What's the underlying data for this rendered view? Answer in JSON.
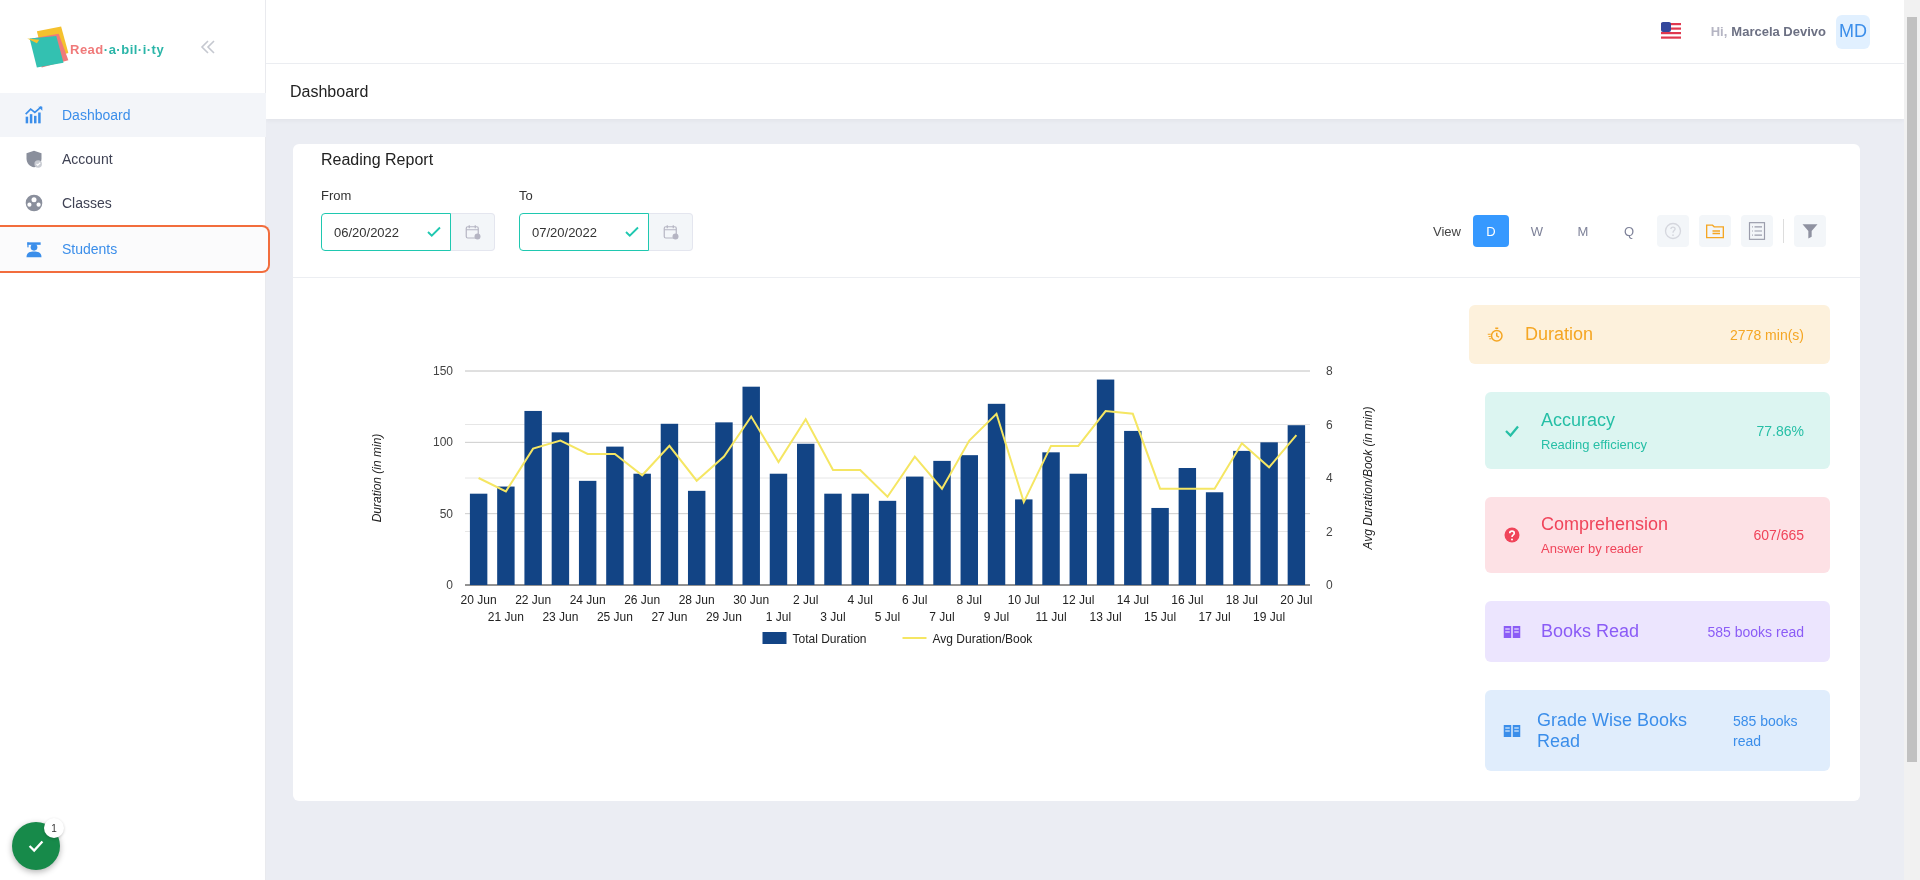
{
  "logo": {
    "parts": [
      "Read",
      "·a·bil·i·ty"
    ]
  },
  "sidebar": {
    "items": [
      {
        "label": "Dashboard",
        "kind": "chart",
        "selected": true,
        "highlighted": false
      },
      {
        "label": "Account",
        "kind": "shield",
        "selected": false,
        "highlighted": false
      },
      {
        "label": "Classes",
        "kind": "group",
        "selected": false,
        "highlighted": false
      },
      {
        "label": "Students",
        "kind": "student",
        "selected": false,
        "highlighted": true
      }
    ]
  },
  "header": {
    "greeting": "Hi,",
    "user_name": "Marcela Devivo",
    "avatar": "MD"
  },
  "page_title": "Dashboard",
  "report": {
    "title": "Reading Report",
    "from": {
      "label": "From",
      "value": "06/20/2022"
    },
    "to": {
      "label": "To",
      "value": "07/20/2022"
    },
    "view": {
      "label": "View",
      "options": [
        {
          "label": "D",
          "selected": true
        },
        {
          "label": "W",
          "selected": false
        },
        {
          "label": "M",
          "selected": false
        },
        {
          "label": "Q",
          "selected": false
        }
      ]
    },
    "chart_data": {
      "type": "bar",
      "ylabel": "Duration (in min)",
      "y2label": "Avg Duration/Book (in min)",
      "categories": [
        "20 Jun",
        "21 Jun",
        "22 Jun",
        "23 Jun",
        "24 Jun",
        "25 Jun",
        "26 Jun",
        "27 Jun",
        "28 Jun",
        "29 Jun",
        "30 Jun",
        "1 Jul",
        "2 Jul",
        "3 Jul",
        "4 Jul",
        "5 Jul",
        "6 Jul",
        "7 Jul",
        "8 Jul",
        "9 Jul",
        "10 Jul",
        "11 Jul",
        "12 Jul",
        "13 Jul",
        "14 Jul",
        "15 Jul",
        "16 Jul",
        "17 Jul",
        "18 Jul",
        "19 Jul",
        "20 Jul"
      ],
      "series": [
        {
          "name": "Total Duration",
          "type": "bar",
          "color": "#124485",
          "values": [
            64,
            69,
            122,
            107,
            73,
            97,
            78,
            113,
            66,
            114,
            139,
            78,
            99,
            64,
            64,
            59,
            76,
            87,
            91,
            127,
            60,
            93,
            78,
            144,
            108,
            54,
            82,
            65,
            94,
            100,
            112
          ]
        },
        {
          "name": "Avg Duration/Book",
          "type": "line",
          "axis": "y2",
          "color": "#f5e663",
          "values": [
            4.0,
            3.5,
            5.1,
            5.4,
            4.9,
            4.9,
            4.1,
            5.2,
            3.9,
            4.8,
            6.3,
            4.6,
            6.2,
            4.3,
            4.3,
            3.3,
            4.8,
            3.6,
            5.4,
            6.4,
            3.1,
            5.2,
            5.2,
            6.5,
            6.4,
            3.6,
            3.6,
            3.6,
            5.3,
            4.4,
            5.6
          ]
        }
      ],
      "grid": true,
      "legend": "bottom",
      "ylim": [
        0,
        150
      ],
      "yticks": [
        0,
        50,
        100,
        150
      ],
      "y2lim": [
        0,
        8
      ],
      "y2ticks": [
        0,
        2,
        4,
        6,
        8
      ]
    },
    "stats": [
      {
        "kind": "timer",
        "title": "Duration",
        "value": "2778 min(s)",
        "color": "#f5a623"
      },
      {
        "kind": "check",
        "title": "Accuracy",
        "subtitle": "Reading efficiency",
        "value": "77.86%",
        "color": "#26bfa6"
      },
      {
        "kind": "question",
        "title": "Comprehension",
        "subtitle": "Answer by reader",
        "value": "607/665",
        "color": "#f0445a"
      },
      {
        "kind": "book",
        "title": "Books Read",
        "value": "585 books read",
        "color": "#8b5cf6"
      },
      {
        "kind": "book",
        "title": "Grade Wise Books Read",
        "value": "585 books read",
        "color": "#3b8eea"
      }
    ]
  },
  "notification": {
    "count": "1"
  }
}
